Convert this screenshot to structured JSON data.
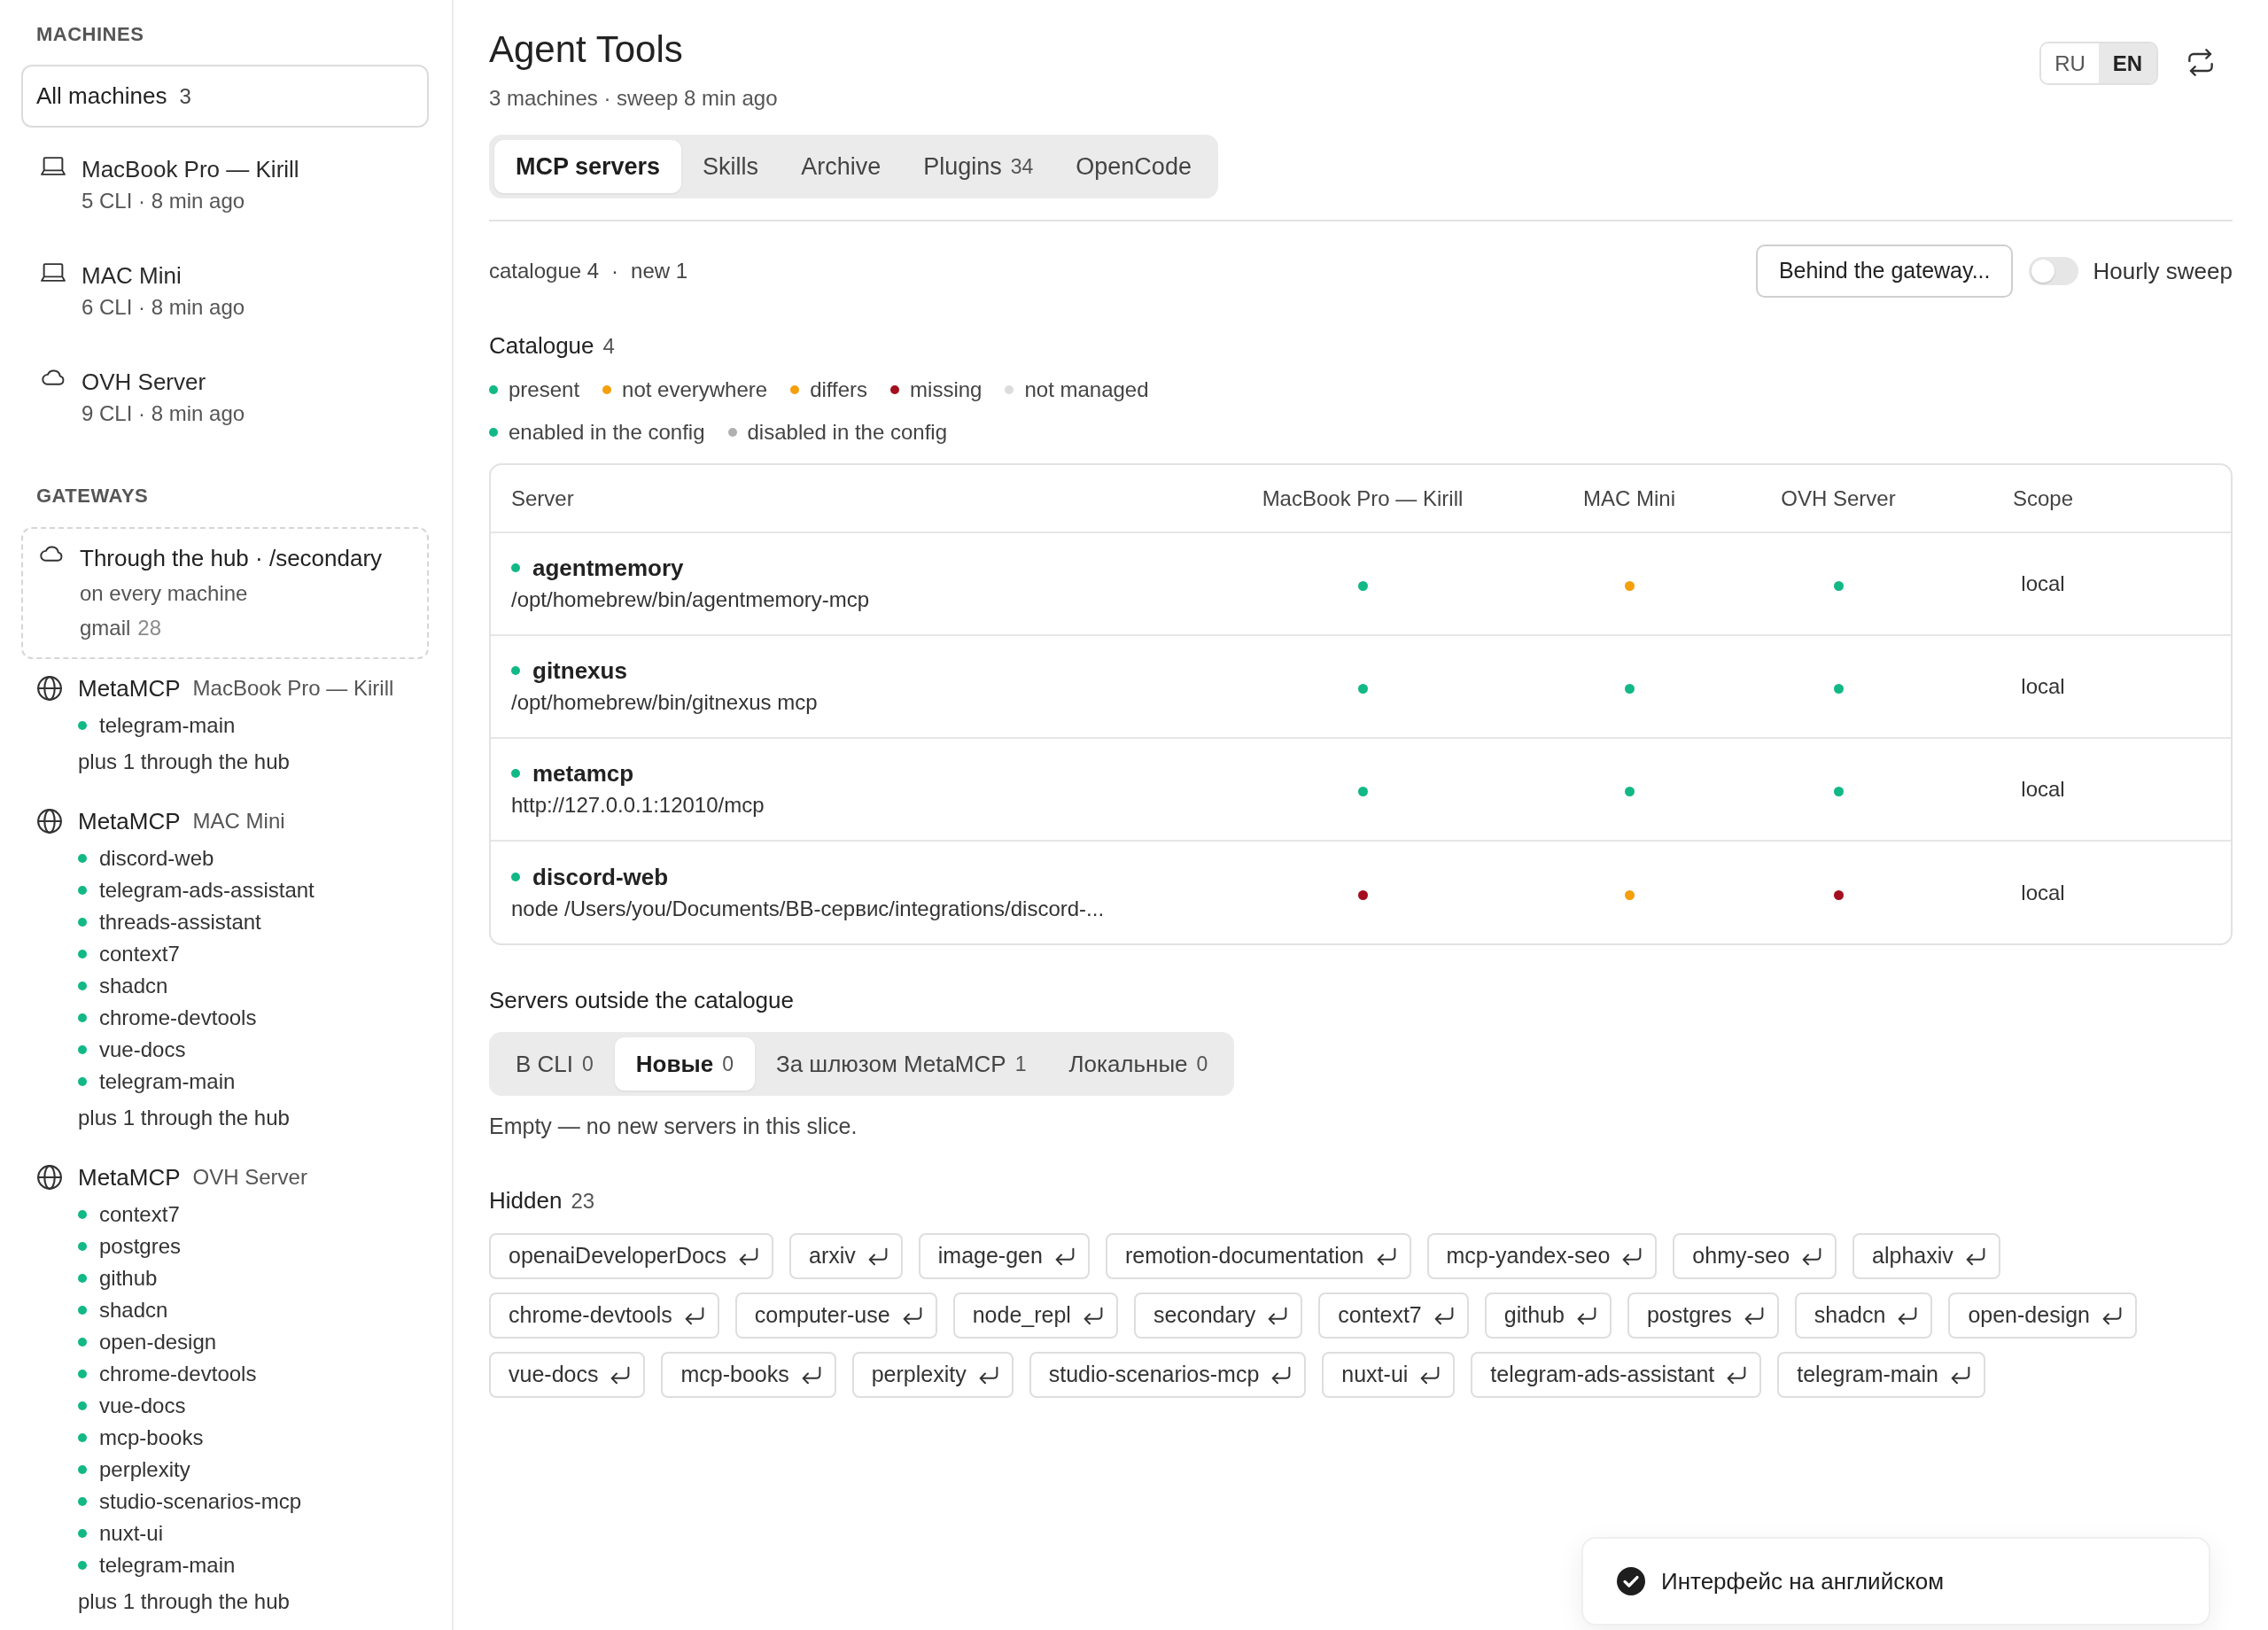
{
  "sidebar": {
    "machines_heading": "MACHINES",
    "all_machines": {
      "label": "All machines",
      "count": "3",
      "selected": true
    },
    "machines": [
      {
        "kind": "laptop",
        "name": "MacBook Pro — Kirill",
        "meta": "5 CLI · 8 min ago",
        "selected": false
      },
      {
        "kind": "laptop",
        "name": "MAC Mini",
        "meta": "6 CLI · 8 min ago",
        "selected": false
      },
      {
        "kind": "cloud",
        "name": "OVH Server",
        "meta": "9 CLI · 8 min ago",
        "selected": false
      }
    ],
    "gateways_heading": "GATEWAYS",
    "hub": {
      "title": "Through the hub · /secondary",
      "scope": "on every machine",
      "server": "gmail",
      "count": "28"
    },
    "gateways": [
      {
        "name": "MetaMCP",
        "machine": "MacBook Pro — Kirill",
        "servers": [
          {
            "name": "telegram-main",
            "enabled": true
          }
        ],
        "note": "plus 1 through the hub"
      },
      {
        "name": "MetaMCP",
        "machine": "MAC Mini",
        "servers": [
          {
            "name": "discord-web",
            "enabled": true
          },
          {
            "name": "telegram-ads-assistant",
            "enabled": true
          },
          {
            "name": "threads-assistant",
            "enabled": true
          },
          {
            "name": "context7",
            "enabled": true
          },
          {
            "name": "shadcn",
            "enabled": true
          },
          {
            "name": "chrome-devtools",
            "enabled": true
          },
          {
            "name": "vue-docs",
            "enabled": true
          },
          {
            "name": "telegram-main",
            "enabled": true
          }
        ],
        "note": "plus 1 through the hub"
      },
      {
        "name": "MetaMCP",
        "machine": "OVH Server",
        "servers": [
          {
            "name": "context7",
            "enabled": true
          },
          {
            "name": "postgres",
            "enabled": true
          },
          {
            "name": "github",
            "enabled": true
          },
          {
            "name": "shadcn",
            "enabled": true
          },
          {
            "name": "open-design",
            "enabled": true
          },
          {
            "name": "chrome-devtools",
            "enabled": true
          },
          {
            "name": "vue-docs",
            "enabled": true
          },
          {
            "name": "mcp-books",
            "enabled": true
          },
          {
            "name": "perplexity",
            "enabled": true
          },
          {
            "name": "studio-scenarios-mcp",
            "enabled": true
          },
          {
            "name": "nuxt-ui",
            "enabled": true
          },
          {
            "name": "telegram-main",
            "enabled": true
          }
        ],
        "note": "plus 1 through the hub"
      }
    ]
  },
  "header": {
    "title": "Agent Tools",
    "subtitle": "3 machines · sweep 8 min ago",
    "languages": [
      {
        "label": "RU",
        "selected": false
      },
      {
        "label": "EN",
        "selected": true
      }
    ]
  },
  "tabs": [
    {
      "label": "MCP servers",
      "selected": true
    },
    {
      "label": "Skills",
      "selected": false
    },
    {
      "label": "Archive",
      "selected": false
    },
    {
      "label": "Plugins",
      "count": "34",
      "selected": false
    },
    {
      "label": "OpenCode",
      "selected": false
    }
  ],
  "toolbar": {
    "summary": [
      "catalogue 4",
      "new 1"
    ],
    "separator": "·",
    "gateway_button": "Behind the gateway...",
    "hourly_sweep": {
      "label": "Hourly sweep",
      "on": false
    }
  },
  "catalogue": {
    "title": "Catalogue",
    "count": "4",
    "legend": [
      {
        "label": "present",
        "color": "#12b886"
      },
      {
        "label": "not everywhere",
        "color": "#f59f0a"
      },
      {
        "label": "differs",
        "color": "#f59f0a"
      },
      {
        "label": "missing",
        "color": "#a30f1e"
      },
      {
        "label": "not managed",
        "color": "#dcdcdc"
      }
    ],
    "config_legend": [
      {
        "label": "enabled in the config",
        "color": "#12b886"
      },
      {
        "label": "disabled in the config",
        "color": "#b0b0b0"
      }
    ],
    "table": {
      "columns": [
        "Server",
        "MacBook Pro — Kirill",
        "MAC Mini",
        "OVH Server",
        "Scope"
      ],
      "rows": [
        {
          "name": "agentmemory",
          "enabled": true,
          "command": "/opt/homebrew/bin/agentmemory-mcp",
          "machines": [
            {
              "color": "#12b886"
            },
            {
              "color": "#f59f0a"
            },
            {
              "color": "#12b886"
            }
          ],
          "scope": "local"
        },
        {
          "name": "gitnexus",
          "enabled": true,
          "command": "/opt/homebrew/bin/gitnexus mcp",
          "machines": [
            {
              "color": "#12b886"
            },
            {
              "color": "#12b886"
            },
            {
              "color": "#12b886"
            }
          ],
          "scope": "local"
        },
        {
          "name": "metamcp",
          "enabled": true,
          "command": "http://127.0.0.1:12010/mcp",
          "machines": [
            {
              "color": "#12b886"
            },
            {
              "color": "#12b886"
            },
            {
              "color": "#12b886"
            }
          ],
          "scope": "local"
        },
        {
          "name": "discord-web",
          "enabled": true,
          "command": "node /Users/you/Documents/BB-сервис/integrations/discord-...",
          "machines": [
            {
              "color": "#a30f1e"
            },
            {
              "color": "#f59f0a"
            },
            {
              "color": "#a30f1e"
            }
          ],
          "scope": "local"
        }
      ]
    }
  },
  "outside": {
    "title": "Servers outside the catalogue",
    "segments": [
      {
        "label": "В CLI",
        "count": "0",
        "selected": false
      },
      {
        "label": "Новые",
        "count": "0",
        "selected": true
      },
      {
        "label": "За шлюзом MetaMCP",
        "count": "1",
        "selected": false
      },
      {
        "label": "Локальные",
        "count": "0",
        "selected": false
      }
    ],
    "empty_text": "Empty — no new servers in this slice."
  },
  "hidden": {
    "title": "Hidden",
    "count": "23",
    "chips": [
      "openaiDeveloperDocs",
      "arxiv",
      "image-gen",
      "remotion-documentation",
      "mcp-yandex-seo",
      "ohmy-seo",
      "alphaxiv",
      "chrome-devtools",
      "computer-use",
      "node_repl",
      "secondary",
      "context7",
      "github",
      "postgres",
      "shadcn",
      "open-design",
      "vue-docs",
      "mcp-books",
      "perplexity",
      "studio-scenarios-mcp",
      "nuxt-ui",
      "telegram-ads-assistant",
      "telegram-main"
    ]
  },
  "toast": {
    "text": "Интерфейс на английском"
  }
}
